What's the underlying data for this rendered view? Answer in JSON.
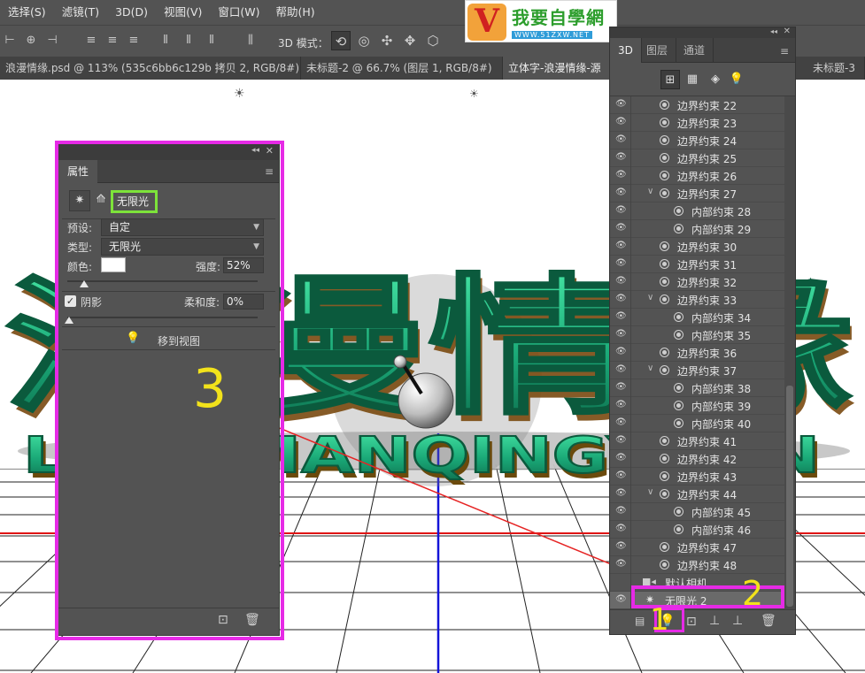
{
  "menu": [
    "选择(S)",
    "滤镜(T)",
    "3D(D)",
    "视图(V)",
    "窗口(W)",
    "帮助(H)"
  ],
  "logo": {
    "letter_v": "V",
    "title": "我要自學網",
    "url": "WWW.51ZXW.NET"
  },
  "options": {
    "mode_label": "3D 模式："
  },
  "doc_tabs": [
    "浪漫情缘.psd @ 113% (535c6bb6c129b 拷贝 2, RGB/8#) *",
    "未标题-2 @ 66.7% (图层 1, RGB/8#)",
    "立体字-浪漫情缘-源",
    "未标题-3"
  ],
  "canvas": {
    "word_latin": "LANGMANQINGYUAN",
    "word_cn": "浪漫情缘"
  },
  "properties": {
    "tab": "属性",
    "light_name": "无限光",
    "preset_label": "预设:",
    "preset_value": "自定",
    "type_label": "类型:",
    "type_value": "无限光",
    "color_label": "颜色:",
    "intensity_label": "强度:",
    "intensity_value": "52%",
    "shadow_checked": true,
    "shadow_label": "阴影",
    "softness_label": "柔和度:",
    "softness_value": "0%",
    "move_to_view": "移到视图"
  },
  "panel3d": {
    "tabs": [
      "3D",
      "图层",
      "通道"
    ],
    "active_tab": "3D",
    "rows": [
      {
        "label": "边界约束 22",
        "level": 1,
        "twist": false
      },
      {
        "label": "边界约束 23",
        "level": 1,
        "twist": false
      },
      {
        "label": "边界约束 24",
        "level": 1,
        "twist": false
      },
      {
        "label": "边界约束 25",
        "level": 1,
        "twist": false
      },
      {
        "label": "边界约束 26",
        "level": 1,
        "twist": false
      },
      {
        "label": "边界约束 27",
        "level": 1,
        "twist": true
      },
      {
        "label": "内部约束 28",
        "level": 2,
        "twist": false
      },
      {
        "label": "内部约束 29",
        "level": 2,
        "twist": false
      },
      {
        "label": "边界约束 30",
        "level": 1,
        "twist": false
      },
      {
        "label": "边界约束 31",
        "level": 1,
        "twist": false
      },
      {
        "label": "边界约束 32",
        "level": 1,
        "twist": false
      },
      {
        "label": "边界约束 33",
        "level": 1,
        "twist": true
      },
      {
        "label": "内部约束 34",
        "level": 2,
        "twist": false
      },
      {
        "label": "内部约束 35",
        "level": 2,
        "twist": false
      },
      {
        "label": "边界约束 36",
        "level": 1,
        "twist": false
      },
      {
        "label": "边界约束 37",
        "level": 1,
        "twist": true
      },
      {
        "label": "内部约束 38",
        "level": 2,
        "twist": false
      },
      {
        "label": "内部约束 39",
        "level": 2,
        "twist": false
      },
      {
        "label": "内部约束 40",
        "level": 2,
        "twist": false
      },
      {
        "label": "边界约束 41",
        "level": 1,
        "twist": false
      },
      {
        "label": "边界约束 42",
        "level": 1,
        "twist": false
      },
      {
        "label": "边界约束 43",
        "level": 1,
        "twist": false
      },
      {
        "label": "边界约束 44",
        "level": 1,
        "twist": true
      },
      {
        "label": "内部约束 45",
        "level": 2,
        "twist": false
      },
      {
        "label": "内部约束 46",
        "level": 2,
        "twist": false
      },
      {
        "label": "边界约束 47",
        "level": 1,
        "twist": false
      },
      {
        "label": "边界约束 48",
        "level": 1,
        "twist": false
      }
    ],
    "camera_label": "默认相机",
    "selected_light": "无限光 2"
  },
  "annotations": {
    "step1": "1",
    "step2": "2",
    "step3": "3"
  },
  "colors": {
    "highlight_magenta": "#e62ae6",
    "highlight_green": "#7de33a",
    "annotation_yellow": "#f2e21b",
    "text_green": "#2fc585"
  }
}
